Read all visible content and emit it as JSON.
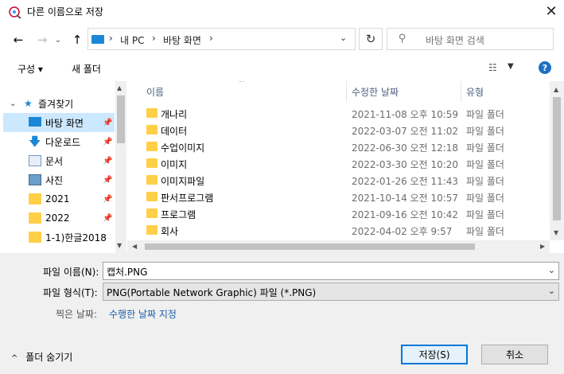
{
  "window": {
    "title": "다른 이름으로 저장"
  },
  "address": {
    "crumbs": [
      "내 PC",
      "바탕 화면"
    ]
  },
  "search": {
    "placeholder": "바탕 화면 검색"
  },
  "toolbar": {
    "organize": "구성 ▾",
    "new_folder": "새 폴더",
    "help": "?"
  },
  "nav": {
    "group": "즐겨찾기",
    "items": [
      {
        "label": "바탕 화면",
        "icon": "desktop-icon",
        "selected": true
      },
      {
        "label": "다운로드",
        "icon": "download-icon"
      },
      {
        "label": "문서",
        "icon": "document-icon"
      },
      {
        "label": "사진",
        "icon": "pictures-icon"
      },
      {
        "label": "2021",
        "icon": "folder-icon"
      },
      {
        "label": "2022",
        "icon": "folder-icon"
      },
      {
        "label": "1-1)한글2018",
        "icon": "folder-icon"
      }
    ]
  },
  "columns": {
    "name": "이름",
    "date": "수정한 날짜",
    "type": "유형"
  },
  "files": [
    {
      "name": "개나리",
      "date": "2021-11-08 오후 10:59",
      "type": "파일 폴더"
    },
    {
      "name": "데이터",
      "date": "2022-03-07 오전 11:02",
      "type": "파일 폴더"
    },
    {
      "name": "수업이미지",
      "date": "2022-06-30 오전 12:18",
      "type": "파일 폴더"
    },
    {
      "name": "이미지",
      "date": "2022-03-30 오전 10:20",
      "type": "파일 폴더"
    },
    {
      "name": "이미지파일",
      "date": "2022-01-26 오전 11:43",
      "type": "파일 폴더"
    },
    {
      "name": "판서프로그램",
      "date": "2021-10-14 오전 10:57",
      "type": "파일 폴더"
    },
    {
      "name": "프로그램",
      "date": "2021-09-16 오전 10:42",
      "type": "파일 폴더"
    },
    {
      "name": "회사",
      "date": "2022-04-02 오후 9:57",
      "type": "파일 폴더"
    }
  ],
  "form": {
    "filename_label": "파일 이름(N):",
    "filename_value": "캡처.PNG",
    "filetype_label": "파일 형식(T):",
    "filetype_value": "PNG(Portable Network Graphic) 파일 (*.PNG)",
    "tags_label": "찍은 날짜:",
    "tags_value": "수행한 날짜 지정"
  },
  "footer": {
    "hide_folders": "폴더 숨기기",
    "save": "저장(S)",
    "cancel": "취소"
  },
  "colors": {
    "accent": "#0078d7",
    "folder": "#ffcf48",
    "selection": "#cce8ff"
  }
}
